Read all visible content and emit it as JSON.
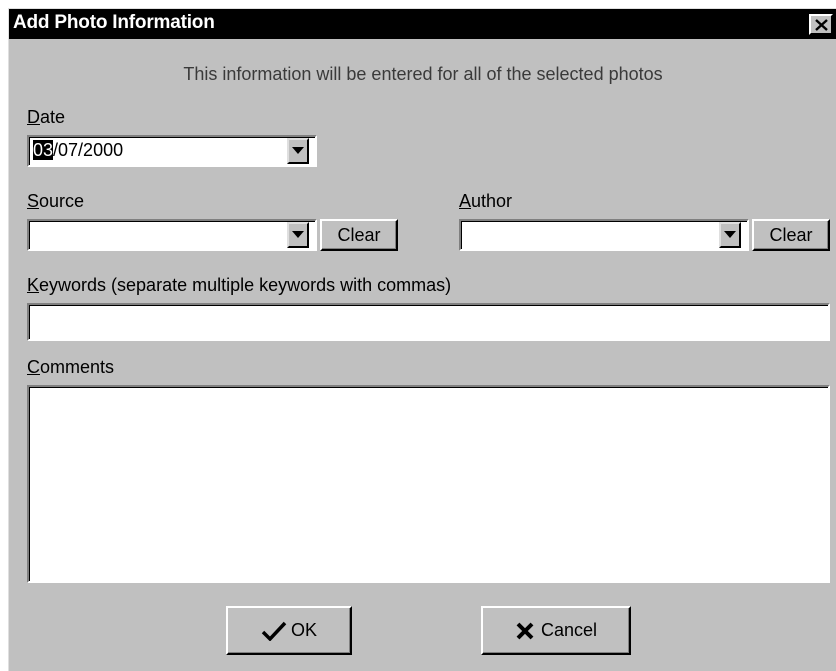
{
  "dialog": {
    "title": "Add Photo Information",
    "close_icon": "close-x-icon",
    "info_text": "This information will be entered for all of the selected photos"
  },
  "date": {
    "label_access": "D",
    "label_rest": "ate",
    "value_selected": "03",
    "value_rest": "/07/2000"
  },
  "source": {
    "label_access": "S",
    "label_rest": "ource",
    "value": "",
    "clear_label": "Clear"
  },
  "author": {
    "label_access": "A",
    "label_rest": "uthor",
    "value": "",
    "clear_label": "Clear"
  },
  "keywords": {
    "label_access": "K",
    "label_rest": "eywords (separate multiple keywords with commas)",
    "value": ""
  },
  "comments": {
    "label_access": "C",
    "label_rest": "omments",
    "value": ""
  },
  "buttons": {
    "ok_label": "OK",
    "ok_icon": "checkmark-icon",
    "cancel_label": "Cancel",
    "cancel_icon": "x-mark-icon"
  }
}
